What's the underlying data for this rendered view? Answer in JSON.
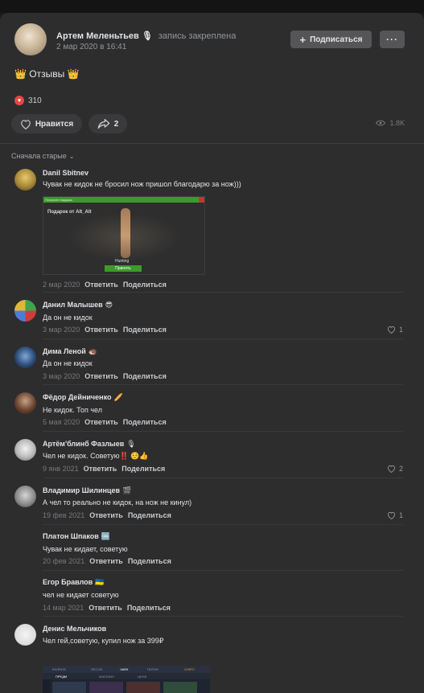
{
  "post": {
    "author": "Артем Меленьтьев",
    "author_emoji": "🎙",
    "pinned_note": "запись закреплена",
    "date": "2 мар 2020 в 16:41",
    "subscribe_label": "Подписаться",
    "more_label": "···",
    "text": "Отзывы",
    "fire_emoji": "👑",
    "likes_count": "310",
    "like_label": "Нравится",
    "share_count": "2",
    "views": "1.8K"
  },
  "comments_header": {
    "sort_label": "Сначала старые"
  },
  "comments": [
    {
      "name": "Danil Sbitnev",
      "emoji": "",
      "text": "Чувак не кидок не бросил нож пришол благодарю за нож)))",
      "date": "2 мар 2020",
      "reply": "Ответить",
      "share": "Поделиться",
      "likes": ""
    },
    {
      "name": "Данил Малышев",
      "emoji": "😎",
      "text": "Да он не кидок",
      "date": "3 мар 2020",
      "reply": "Ответить",
      "share": "Поделиться",
      "likes": "1"
    },
    {
      "name": "Дима Леной",
      "emoji": "🦔",
      "text": "Да он не кидок",
      "date": "3 мар 2020",
      "reply": "Ответить",
      "share": "Поделиться",
      "likes": ""
    },
    {
      "name": "Фёдор Дейниченко",
      "emoji": "🥖",
      "text": "Не кидок. Топ чел",
      "date": "5 мая 2020",
      "reply": "Ответить",
      "share": "Поделиться",
      "likes": ""
    },
    {
      "name": "Артём'блинб Фазлыев",
      "emoji": "🎙",
      "text": "Чел не кидок. Советую",
      "text_emoji": "‼️ ☺️👍",
      "date": "9 янв 2021",
      "reply": "Ответить",
      "share": "Поделиться",
      "likes": "2"
    },
    {
      "name": "Владимир Шилинцев",
      "emoji": "🎬",
      "text": "А чел то реально не кидок, на нож не кинул)",
      "date": "19 фев 2021",
      "reply": "Ответить",
      "share": "Поделиться",
      "likes": "1"
    },
    {
      "name": "Платон Шпаков",
      "emoji": "🆒",
      "text": "Чувак не кидает, советую",
      "date": "20 фев 2021",
      "reply": "Ответить",
      "share": "Поделиться",
      "likes": ""
    },
    {
      "name": "Егор Бравлов",
      "emoji": "🇺🇦",
      "text": "чел не кидает советую",
      "date": "14 мар 2021",
      "reply": "Ответить",
      "share": "Поделиться",
      "likes": ""
    },
    {
      "name": "Денис Мельчиков",
      "emoji": "",
      "text": "Чел гей,советую, купил нож за 399₽",
      "date": "",
      "reply": "",
      "share": "",
      "likes": ""
    }
  ],
  "attachments": {
    "gift_title": "Подарок от Alt_Alt",
    "gift_header": "Получите подарок",
    "gift_item": "Hunting",
    "gift_button": "Принять",
    "game_tabs": [
      "INVENTA",
      "SECON",
      "ЧАЕК",
      "ПИТОН",
      "CHIFO"
    ],
    "game_subtabs": [
      "ПРЕДМ",
      "МАГАЗИН",
      "ЦЕНА"
    ]
  },
  "colors": {
    "background": "#1b1b1c",
    "card": "#2d2d2e",
    "button": "#555558",
    "like_heart": "#e64646",
    "gift_green": "#3c9a2a"
  }
}
